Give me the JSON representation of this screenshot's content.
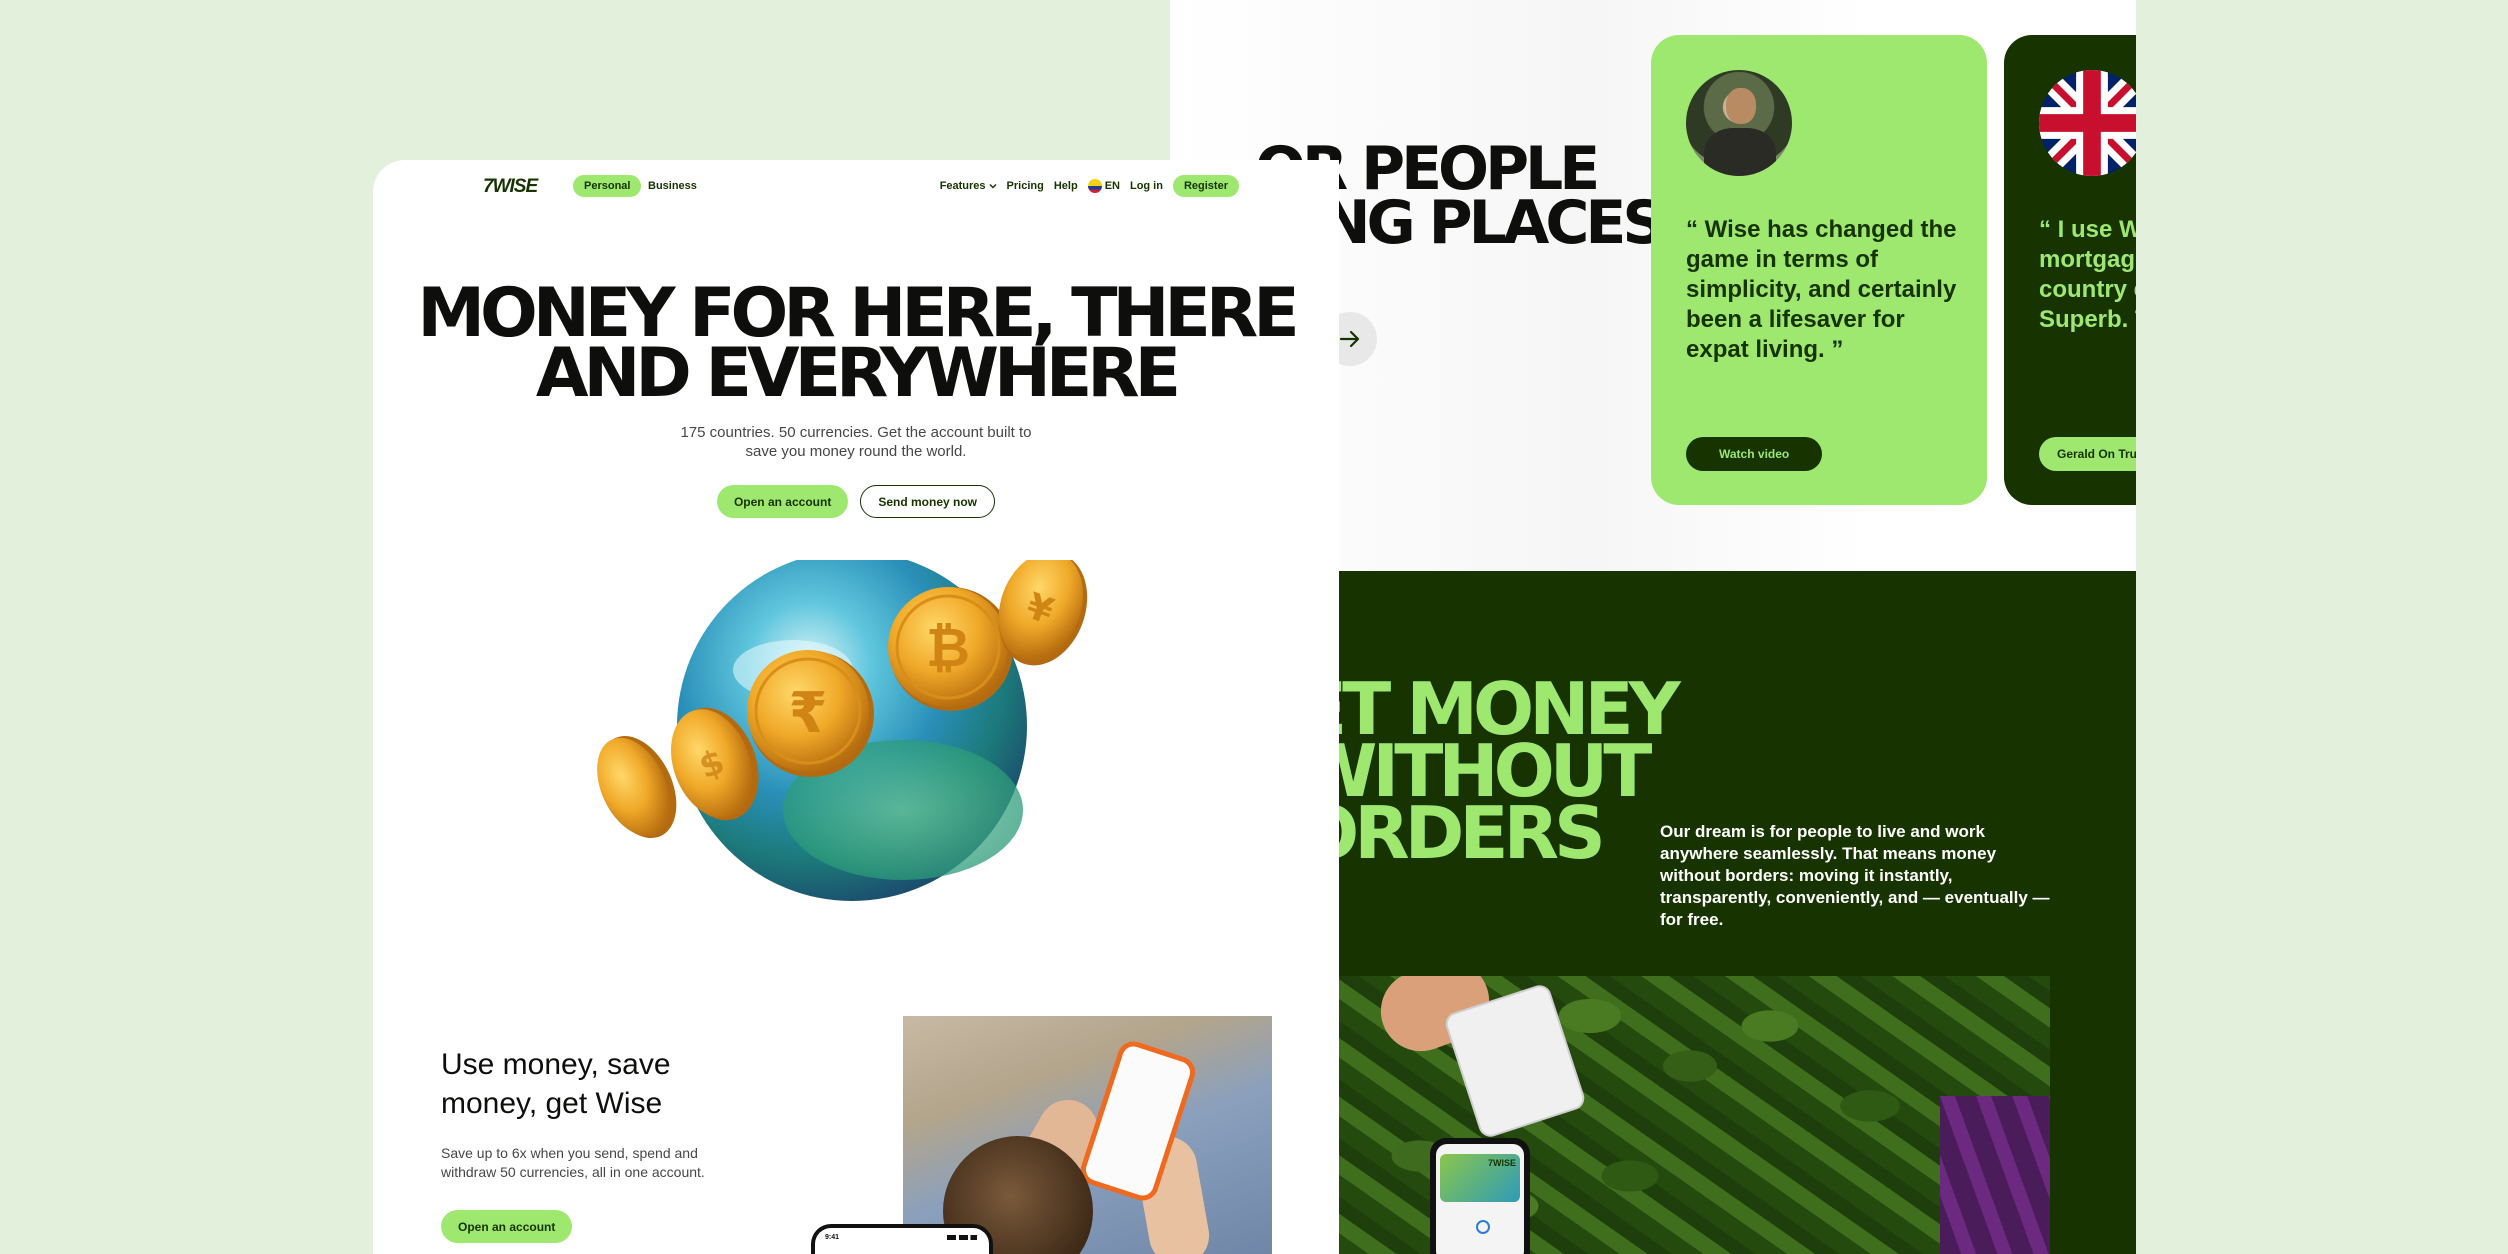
{
  "colors": {
    "background": "#e3f1dc",
    "brand_green": "#9fe870",
    "forest_green": "#163300",
    "text_dark": "#0e0f0c"
  },
  "back": {
    "people_heading": "OR PEOPLE\nOING PLACES",
    "arrow_icon": "arrow-right-icon",
    "testimonials": [
      {
        "quote": "“ Wise has changed the game in terms of simplicity, and certainly been a lifesaver for expat living. ”",
        "button": "Watch video"
      },
      {
        "quote": "“ I use Wi\nmortgage\ncountry e\nSuperb. T",
        "button": "Gerald On Trus"
      }
    ],
    "borders_heading": "ET MONEY WITHOUT\nORDERS",
    "dream_text": "Our dream is for people to live and work anywhere seamlessly. That means money without borders: moving it instantly, transparently, conveniently, and — eventually — for free.",
    "phone_logo": "7WISE"
  },
  "nav": {
    "logo": "7WISE",
    "personal": "Personal",
    "business": "Business",
    "features": "Features",
    "pricing": "Pricing",
    "help": "Help",
    "language": "EN",
    "login": "Log in",
    "register": "Register"
  },
  "hero": {
    "title": "MONEY FOR HERE, THERE\nAND EVERYWHERE",
    "subtitle": "175 countries. 50 currencies. Get the account built to save you money round the world.",
    "primary_cta": "Open an account",
    "secondary_cta": "Send money now"
  },
  "use_section": {
    "title": "Use money, save money, get Wise",
    "subtitle": "Save up to 6x when you send, spend and withdraw 50 currencies, all in one account.",
    "cta": "Open an account",
    "phone_time": "9:41"
  }
}
